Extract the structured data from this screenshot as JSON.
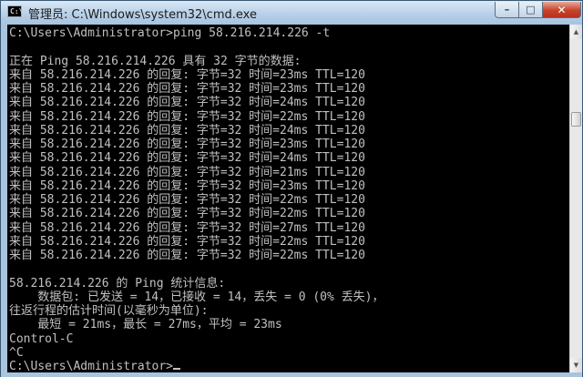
{
  "window": {
    "icon_text": "C:\\",
    "title": "管理员: C:\\Windows\\system32\\cmd.exe",
    "controls": {
      "minimize": "–",
      "maximize": "□",
      "close": "✕"
    }
  },
  "console": {
    "lines": [
      "C:\\Users\\Administrator>ping 58.216.214.226 -t",
      "",
      "正在 Ping 58.216.214.226 具有 32 字节的数据:",
      "来自 58.216.214.226 的回复: 字节=32 时间=23ms TTL=120",
      "来自 58.216.214.226 的回复: 字节=32 时间=23ms TTL=120",
      "来自 58.216.214.226 的回复: 字节=32 时间=24ms TTL=120",
      "来自 58.216.214.226 的回复: 字节=32 时间=22ms TTL=120",
      "来自 58.216.214.226 的回复: 字节=32 时间=24ms TTL=120",
      "来自 58.216.214.226 的回复: 字节=32 时间=23ms TTL=120",
      "来自 58.216.214.226 的回复: 字节=32 时间=24ms TTL=120",
      "来自 58.216.214.226 的回复: 字节=32 时间=21ms TTL=120",
      "来自 58.216.214.226 的回复: 字节=32 时间=23ms TTL=120",
      "来自 58.216.214.226 的回复: 字节=32 时间=22ms TTL=120",
      "来自 58.216.214.226 的回复: 字节=32 时间=22ms TTL=120",
      "来自 58.216.214.226 的回复: 字节=32 时间=27ms TTL=120",
      "来自 58.216.214.226 的回复: 字节=32 时间=22ms TTL=120",
      "来自 58.216.214.226 的回复: 字节=32 时间=22ms TTL=120",
      "",
      "58.216.214.226 的 Ping 统计信息:",
      "    数据包: 已发送 = 14，已接收 = 14，丢失 = 0 (0% 丢失)，",
      "往返行程的估计时间(以毫秒为单位):",
      "    最短 = 21ms，最长 = 27ms，平均 = 23ms",
      "Control-C",
      "^C",
      "C:\\Users\\Administrator>"
    ]
  },
  "scrollbar": {
    "up_arrow": "▲",
    "down_arrow": "▼"
  },
  "colors": {
    "console_bg": "#000000",
    "console_fg": "#c0c0c0",
    "title_bg": "#b9d1e8"
  }
}
